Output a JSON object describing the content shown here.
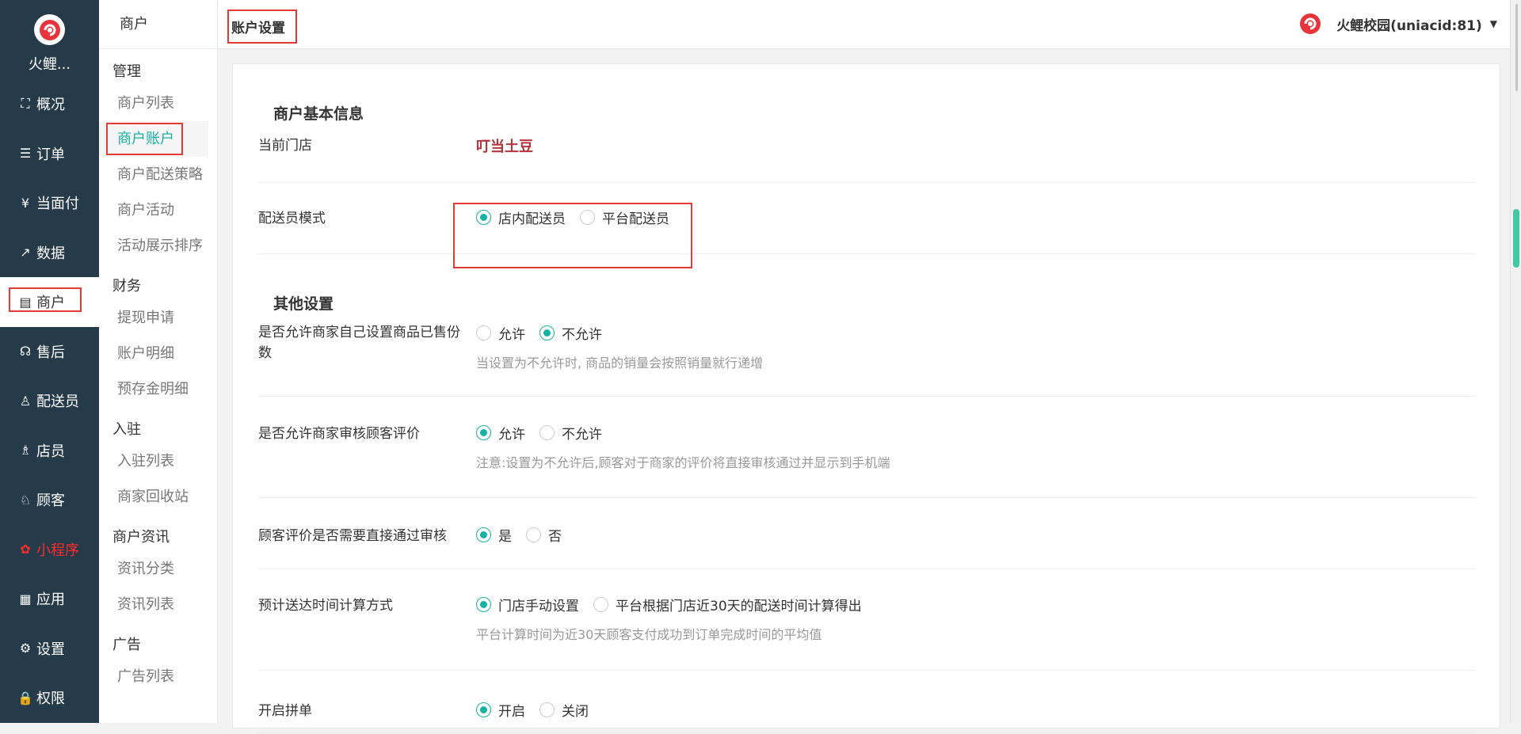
{
  "brand": {
    "name": "火鲤..."
  },
  "nav": [
    {
      "key": "overview",
      "label": "概况",
      "icon": "dashboard-icon"
    },
    {
      "key": "orders",
      "label": "订单",
      "icon": "list-icon"
    },
    {
      "key": "pay",
      "label": "当面付",
      "icon": "yen-icon"
    },
    {
      "key": "data",
      "label": "数据",
      "icon": "chart-icon"
    },
    {
      "key": "merchant",
      "label": "商户",
      "icon": "store-icon",
      "active": true
    },
    {
      "key": "aftersale",
      "label": "售后",
      "icon": "headset-icon"
    },
    {
      "key": "courier",
      "label": "配送员",
      "icon": "user-icon"
    },
    {
      "key": "clerk",
      "label": "店员",
      "icon": "clerk-icon"
    },
    {
      "key": "customer",
      "label": "顾客",
      "icon": "customer-icon"
    },
    {
      "key": "miniapp",
      "label": "小程序",
      "icon": "miniapp-icon",
      "highlight": true
    },
    {
      "key": "apps",
      "label": "应用",
      "icon": "apps-icon"
    },
    {
      "key": "settings",
      "label": "设置",
      "icon": "gear-icon"
    },
    {
      "key": "perm",
      "label": "权限",
      "icon": "lock-icon"
    }
  ],
  "submenu": {
    "header": "商户",
    "groups": [
      {
        "title": "管理",
        "items": [
          "商户列表",
          "商户账户",
          "商户配送策略",
          "商户活动",
          "活动展示排序"
        ]
      },
      {
        "title": "财务",
        "items": [
          "提现申请",
          "账户明细",
          "预存金明细"
        ]
      },
      {
        "title": "入驻",
        "items": [
          "入驻列表",
          "商家回收站"
        ]
      },
      {
        "title": "商户资讯",
        "items": [
          "资讯分类",
          "资讯列表"
        ]
      },
      {
        "title": "广告",
        "items": [
          "广告列表"
        ]
      }
    ],
    "active_item": "商户账户"
  },
  "header": {
    "page_title": "账户设置",
    "account_name": "火鲤校园(uniacid:81)"
  },
  "content": {
    "basic_title": "商户基本信息",
    "current_store_label": "当前门店",
    "current_store_value": "叮当土豆",
    "delivery_mode_label": "配送员模式",
    "delivery_mode_options": [
      "店内配送员",
      "平台配送员"
    ],
    "delivery_mode_selected": 0,
    "other_title": "其他设置",
    "settings": [
      {
        "label": "是否允许商家自己设置商品已售份数",
        "options": [
          "允许",
          "不允许"
        ],
        "selected": 1,
        "hint": "当设置为不允许时, 商品的销量会按照销量就行递增"
      },
      {
        "label": "是否允许商家审核顾客评价",
        "options": [
          "允许",
          "不允许"
        ],
        "selected": 0,
        "hint": "注意:设置为不允许后,顾客对于商家的评价将直接审核通过并显示到手机端"
      },
      {
        "label": "顾客评价是否需要直接通过审核",
        "options": [
          "是",
          "否"
        ],
        "selected": 0,
        "hint": ""
      },
      {
        "label": "预计送达时间计算方式",
        "options": [
          "门店手动设置",
          "平台根据门店近30天的配送时间计算得出"
        ],
        "selected": 0,
        "hint": "平台计算时间为近30天顾客支付成功到订单完成时间的平均值"
      },
      {
        "label": "开启拼单",
        "options": [
          "开启",
          "关闭"
        ],
        "selected": 0,
        "hint": ""
      }
    ]
  },
  "colors": {
    "nav_bg": "#263b4a",
    "accent": "#16b2a4",
    "highlight_red": "#e53935",
    "store_name": "#b3343c"
  }
}
